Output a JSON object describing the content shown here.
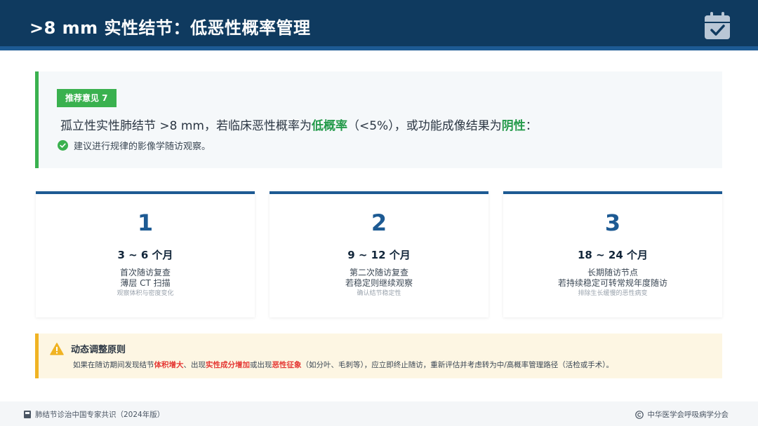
{
  "header": {
    "title": ">8 mm 实性结节：低恶性概率管理",
    "icon": "calendar-check-icon"
  },
  "recommendation": {
    "badge": "推荐意见 7",
    "main_parts": [
      "孤立性实性肺结节 >8 mm，若临床恶性概率为",
      "低概率",
      "（<5%），或功能成像结果为",
      "阴性",
      "："
    ],
    "sub": "建议进行规律的影像学随访观察。",
    "icon": "check-circle-icon"
  },
  "steps": [
    {
      "number": "1",
      "period": "3 ~ 6 个月",
      "line1": "首次随访复查",
      "line2": "薄层 CT 扫描",
      "note": "观察体积与密度变化"
    },
    {
      "number": "2",
      "period": "9 ~ 12 个月",
      "line1": "第二次随访复查",
      "line2": "若稳定则继续观察",
      "note": "确认结节稳定性"
    },
    {
      "number": "3",
      "period": "18 ~ 24 个月",
      "line1": "长期随访节点",
      "line2": "若持续稳定可转常规年度随访",
      "note": "排除生长缓慢的恶性病变"
    }
  ],
  "warning": {
    "title": "动态调整原则",
    "text_parts": [
      "如果在随访期间发现结节",
      "体积增大",
      "、出现",
      "实性成分增加",
      "或出现",
      "恶性征象",
      "（如分叶、毛刺等），应立即终止随访，重新评估并考虑转为中/高概率管理路径（活检或手术）。"
    ],
    "icon": "warning-triangle-icon"
  },
  "footer": {
    "left": "肺结节诊治中国专家共识（2024年版）",
    "right": "中华医学会呼吸病学分会",
    "left_icon": "book-icon",
    "right_icon": "copyright-icon"
  },
  "colors": {
    "header_bg": "#0f3a5f",
    "accent_blue": "#1d5a93",
    "accent_green": "#3ab14f",
    "highlight_green": "#249a4a",
    "warning_yellow": "#f0b323",
    "warning_red": "#e53935"
  }
}
